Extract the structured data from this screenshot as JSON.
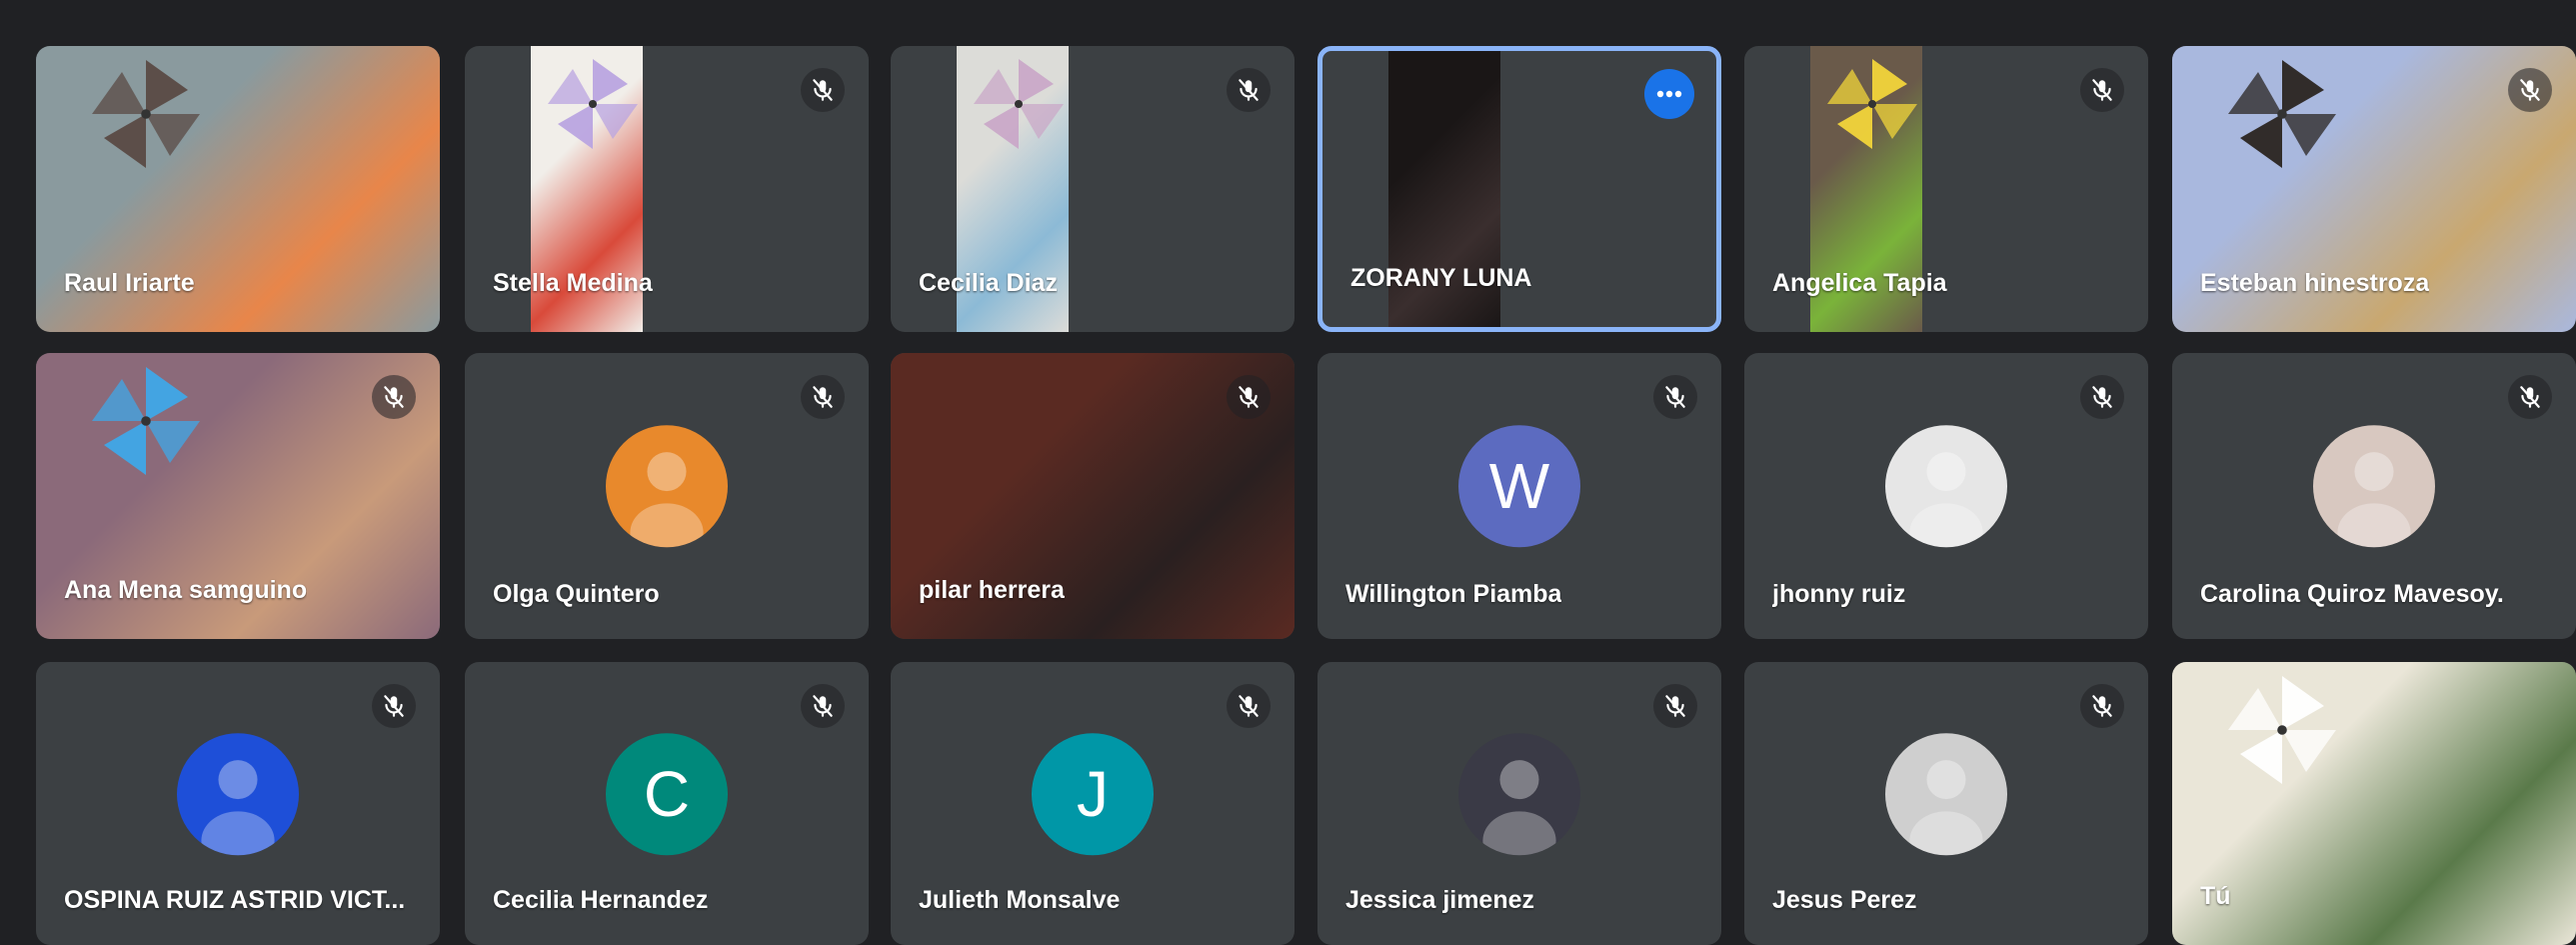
{
  "colors": {
    "background": "#202124",
    "tile": "#3c4043",
    "active_border": "#8ab4f8",
    "more_button": "#1a73e8"
  },
  "tiles": [
    {
      "name": "Raul Iriarte",
      "muted": false,
      "kind": "video",
      "palette": [
        "#8a9a9e",
        "#5a4a44",
        "#e8864a"
      ]
    },
    {
      "name": "Stella Medina",
      "muted": true,
      "kind": "video",
      "palette": [
        "#f1eee9",
        "#b9a4e0",
        "#d94a3a"
      ]
    },
    {
      "name": "Cecilia Diaz",
      "muted": true,
      "kind": "video",
      "palette": [
        "#dcdcd8",
        "#c9a8c8",
        "#8cbad6"
      ]
    },
    {
      "name": "ZORANY LUNA",
      "muted": false,
      "kind": "video",
      "active": true,
      "palette": [
        "#1a1616",
        "#2a2222",
        "#3a2e2e"
      ]
    },
    {
      "name": "Angelica Tapia",
      "muted": true,
      "kind": "video",
      "palette": [
        "#6a5a4a",
        "#f2d53a",
        "#7ab33a"
      ]
    },
    {
      "name": "Esteban hinestroza",
      "muted": true,
      "kind": "video",
      "palette": [
        "#a9b8de",
        "#2a2420",
        "#c9a870"
      ]
    },
    {
      "name": "Ana Mena samguino",
      "muted": true,
      "kind": "video",
      "palette": [
        "#8b6a7a",
        "#3fa8e8",
        "#c89a7a"
      ]
    },
    {
      "name": "Olga Quintero",
      "muted": true,
      "kind": "photo",
      "avatar_bg": "#e8892c"
    },
    {
      "name": "pilar herrera",
      "muted": true,
      "kind": "video",
      "palette": [
        "#5a2a22",
        "#b07a5a",
        "#2a2020"
      ]
    },
    {
      "name": "Willington Piamba",
      "muted": true,
      "kind": "letter",
      "letter": "W",
      "avatar_bg": "#5c6bc0"
    },
    {
      "name": "jhonny ruiz",
      "muted": true,
      "kind": "photo",
      "avatar_bg": "#e6e6e6"
    },
    {
      "name": "Carolina Quiroz Mavesoy.",
      "muted": true,
      "kind": "photo",
      "avatar_bg": "#d8c8c0"
    },
    {
      "name": "OSPINA RUIZ ASTRID VICT...",
      "muted": true,
      "kind": "photo",
      "avatar_bg": "#1e4fd8"
    },
    {
      "name": "Cecilia Hernandez",
      "muted": true,
      "kind": "letter",
      "letter": "C",
      "avatar_bg": "#00897b"
    },
    {
      "name": "Julieth Monsalve",
      "muted": true,
      "kind": "letter",
      "letter": "J",
      "avatar_bg": "#0097a7"
    },
    {
      "name": "Jessica jimenez",
      "muted": true,
      "kind": "photo",
      "avatar_bg": "#3a3a46"
    },
    {
      "name": "Jesus Perez",
      "muted": true,
      "kind": "photo",
      "avatar_bg": "#cfcfcf"
    },
    {
      "name": "Tú",
      "muted": false,
      "kind": "video",
      "self": true,
      "palette": [
        "#eae6d8",
        "#ffffff",
        "#5a7a4a"
      ]
    }
  ]
}
